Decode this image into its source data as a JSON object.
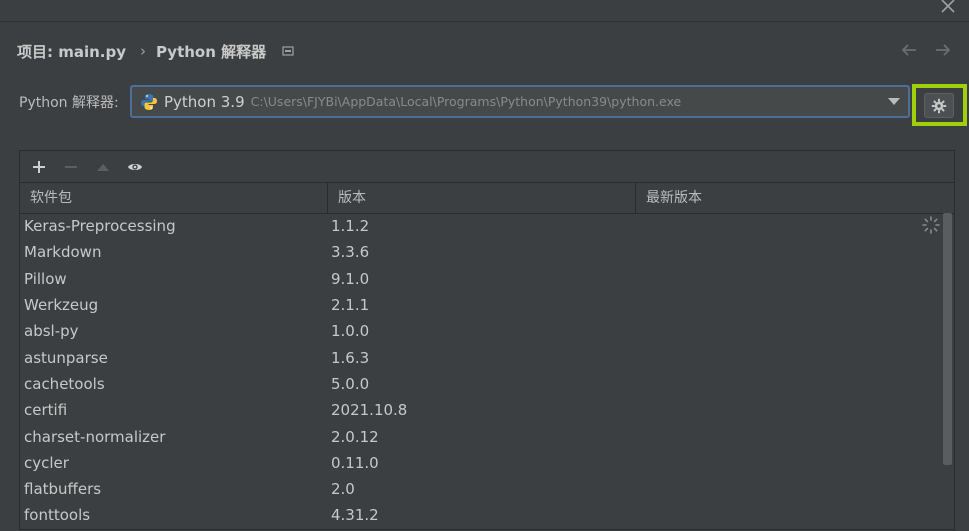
{
  "breadcrumb": {
    "project": "项目: main.py",
    "separator": "›",
    "current": "Python 解释器"
  },
  "interpreter": {
    "label": "Python 解释器:",
    "name": "Python 3.9",
    "path": "C:\\Users\\FJYBi\\AppData\\Local\\Programs\\Python\\Python39\\python.exe"
  },
  "toolbar": {
    "icons": [
      "plus-icon",
      "minus-icon",
      "up-icon",
      "eye-icon"
    ]
  },
  "table": {
    "columns": [
      "软件包",
      "版本",
      "最新版本"
    ],
    "rows": [
      {
        "name": "Keras-Preprocessing",
        "version": "1.1.2",
        "latest": ""
      },
      {
        "name": "Markdown",
        "version": "3.3.6",
        "latest": ""
      },
      {
        "name": "Pillow",
        "version": "9.1.0",
        "latest": ""
      },
      {
        "name": "Werkzeug",
        "version": "2.1.1",
        "latest": ""
      },
      {
        "name": "absl-py",
        "version": "1.0.0",
        "latest": ""
      },
      {
        "name": "astunparse",
        "version": "1.6.3",
        "latest": ""
      },
      {
        "name": "cachetools",
        "version": "5.0.0",
        "latest": ""
      },
      {
        "name": "certifi",
        "version": "2021.10.8",
        "latest": ""
      },
      {
        "name": "charset-normalizer",
        "version": "2.0.12",
        "latest": ""
      },
      {
        "name": "cycler",
        "version": "0.11.0",
        "latest": ""
      },
      {
        "name": "flatbuffers",
        "version": "2.0",
        "latest": ""
      },
      {
        "name": "fonttools",
        "version": "4.31.2",
        "latest": ""
      }
    ]
  },
  "colors": {
    "background": "#3c3f41",
    "highlight_box": "#a0d00c",
    "select_border": "#4c6e98"
  }
}
